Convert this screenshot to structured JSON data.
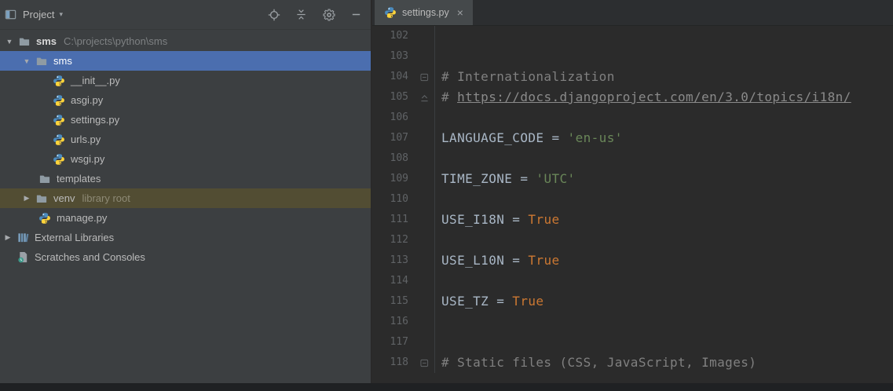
{
  "project_panel": {
    "header": {
      "title": "Project",
      "chevron_glyph": "▾",
      "actions": [
        {
          "name": "locate-button",
          "icon": "locate-icon"
        },
        {
          "name": "collapse-all-button",
          "icon": "collapse-all-icon"
        },
        {
          "name": "settings-button",
          "icon": "gear-icon"
        },
        {
          "name": "hide-panel-button",
          "icon": "hide-icon"
        }
      ]
    },
    "tree": [
      {
        "id": "root-sms",
        "pad": 2,
        "chevron": "down",
        "icon": "folder-icon",
        "label": "sms",
        "bold": true,
        "suffix": "C:\\projects\\python\\sms"
      },
      {
        "id": "sms",
        "pad": 24,
        "chevron": "down",
        "icon": "folder-icon",
        "label": "sms",
        "selected": true
      },
      {
        "id": "init-py",
        "pad": 66,
        "chevron": null,
        "icon": "python-icon",
        "label": "__init__.py"
      },
      {
        "id": "asgi-py",
        "pad": 66,
        "chevron": null,
        "icon": "python-icon",
        "label": "asgi.py"
      },
      {
        "id": "settings-py",
        "pad": 66,
        "chevron": null,
        "icon": "python-icon",
        "label": "settings.py"
      },
      {
        "id": "urls-py",
        "pad": 66,
        "chevron": null,
        "icon": "python-icon",
        "label": "urls.py"
      },
      {
        "id": "wsgi-py",
        "pad": 66,
        "chevron": null,
        "icon": "python-icon",
        "label": "wsgi.py"
      },
      {
        "id": "templates",
        "pad": 48,
        "chevron": null,
        "icon": "folder-icon",
        "label": "templates"
      },
      {
        "id": "venv",
        "pad": 24,
        "chevron": "right",
        "icon": "folder-icon",
        "label": "venv",
        "suffix": "library root",
        "highlight": true
      },
      {
        "id": "manage-py",
        "pad": 48,
        "chevron": null,
        "icon": "python-icon",
        "label": "manage.py"
      },
      {
        "id": "external-libraries",
        "pad": 0,
        "chevron": "right",
        "icon": "libraries-icon",
        "label": "External Libraries"
      },
      {
        "id": "scratches",
        "pad": 20,
        "chevron": null,
        "icon": "scratches-icon",
        "label": "Scratches and Consoles"
      }
    ]
  },
  "editor": {
    "tab": {
      "label": "settings.py",
      "icon": "python-icon",
      "close_glyph": "×"
    },
    "lines": [
      {
        "num": "102",
        "segments": []
      },
      {
        "num": "103",
        "segments": []
      },
      {
        "num": "104",
        "gutter_icon": "fold-rect-icon",
        "segments": [
          {
            "t": "comment",
            "text": "# Internationalization"
          }
        ]
      },
      {
        "num": "105",
        "gutter_icon": "fold-up-icon",
        "segments": [
          {
            "t": "comment",
            "text": "# "
          },
          {
            "t": "link",
            "text": "https://docs.djangoproject.com/en/3.0/topics/i18n/"
          }
        ]
      },
      {
        "num": "106",
        "segments": []
      },
      {
        "num": "107",
        "segments": [
          {
            "t": "plain",
            "text": "LANGUAGE_CODE = "
          },
          {
            "t": "string",
            "text": "'en-us'"
          }
        ]
      },
      {
        "num": "108",
        "segments": []
      },
      {
        "num": "109",
        "segments": [
          {
            "t": "plain",
            "text": "TIME_ZONE = "
          },
          {
            "t": "string",
            "text": "'UTC'"
          }
        ]
      },
      {
        "num": "110",
        "segments": []
      },
      {
        "num": "111",
        "segments": [
          {
            "t": "plain",
            "text": "USE_I18N = "
          },
          {
            "t": "keyword",
            "text": "True"
          }
        ]
      },
      {
        "num": "112",
        "segments": []
      },
      {
        "num": "113",
        "segments": [
          {
            "t": "plain",
            "text": "USE_L10N = "
          },
          {
            "t": "keyword",
            "text": "True"
          }
        ]
      },
      {
        "num": "114",
        "segments": []
      },
      {
        "num": "115",
        "segments": [
          {
            "t": "plain",
            "text": "USE_TZ = "
          },
          {
            "t": "keyword",
            "text": "True"
          }
        ]
      },
      {
        "num": "116",
        "segments": []
      },
      {
        "num": "117",
        "segments": []
      },
      {
        "num": "118",
        "gutter_icon": "fold-rect-icon",
        "segments": [
          {
            "t": "comment",
            "text": "# Static files (CSS, JavaScript, Images)"
          }
        ]
      }
    ]
  },
  "colors": {
    "selection_blue": "#4b6eaf",
    "venv_highlight": "#524d33",
    "string_green": "#6a8759",
    "keyword_orange": "#cc7832",
    "comment_gray": "#808080"
  }
}
